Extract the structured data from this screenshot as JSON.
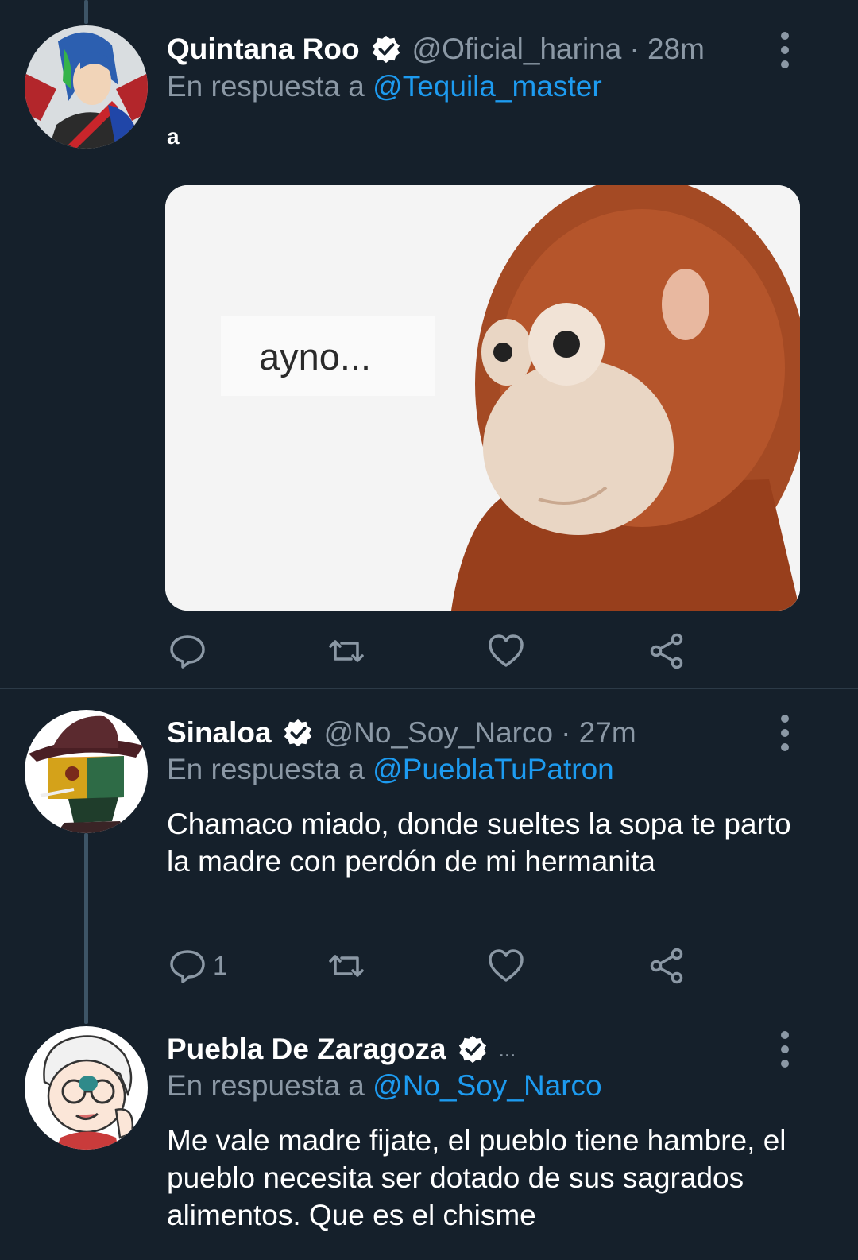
{
  "tweets": [
    {
      "name": "Quintana Roo",
      "handle": "@Oficial_harina",
      "time": "· 28m",
      "reply_prefix": "En respuesta a",
      "reply_to": "@Tequila_master",
      "text": "a",
      "media_caption": "ayno...",
      "reply_count": "",
      "avatar_icon": "anime-avatar-icon"
    },
    {
      "name": "Sinaloa",
      "handle": "@No_Soy_Narco",
      "time": "· 27m",
      "reply_prefix": "En respuesta a",
      "reply_to": "@PueblaTuPatron",
      "text": "Chamaco miado, donde sueltes la sopa te parto la madre con perdón de mi hermanita",
      "reply_count": "1",
      "avatar_icon": "cowboy-hat-avatar-icon"
    },
    {
      "name": "Puebla De Zaragoza",
      "handle": "...",
      "time": "",
      "reply_prefix": "En respuesta a",
      "reply_to": "@No_Soy_Narco",
      "text": "Me vale madre fijate, el pueblo tiene hambre, el pueblo necesita ser dotado de sus sagrados alimentos. Que es el chisme",
      "avatar_icon": "white-hair-avatar-icon"
    }
  ],
  "colors": {
    "background": "#15202b",
    "accent": "#1d9bf0",
    "secondary_text": "#8b98a5",
    "thread_line": "#3d5466"
  }
}
